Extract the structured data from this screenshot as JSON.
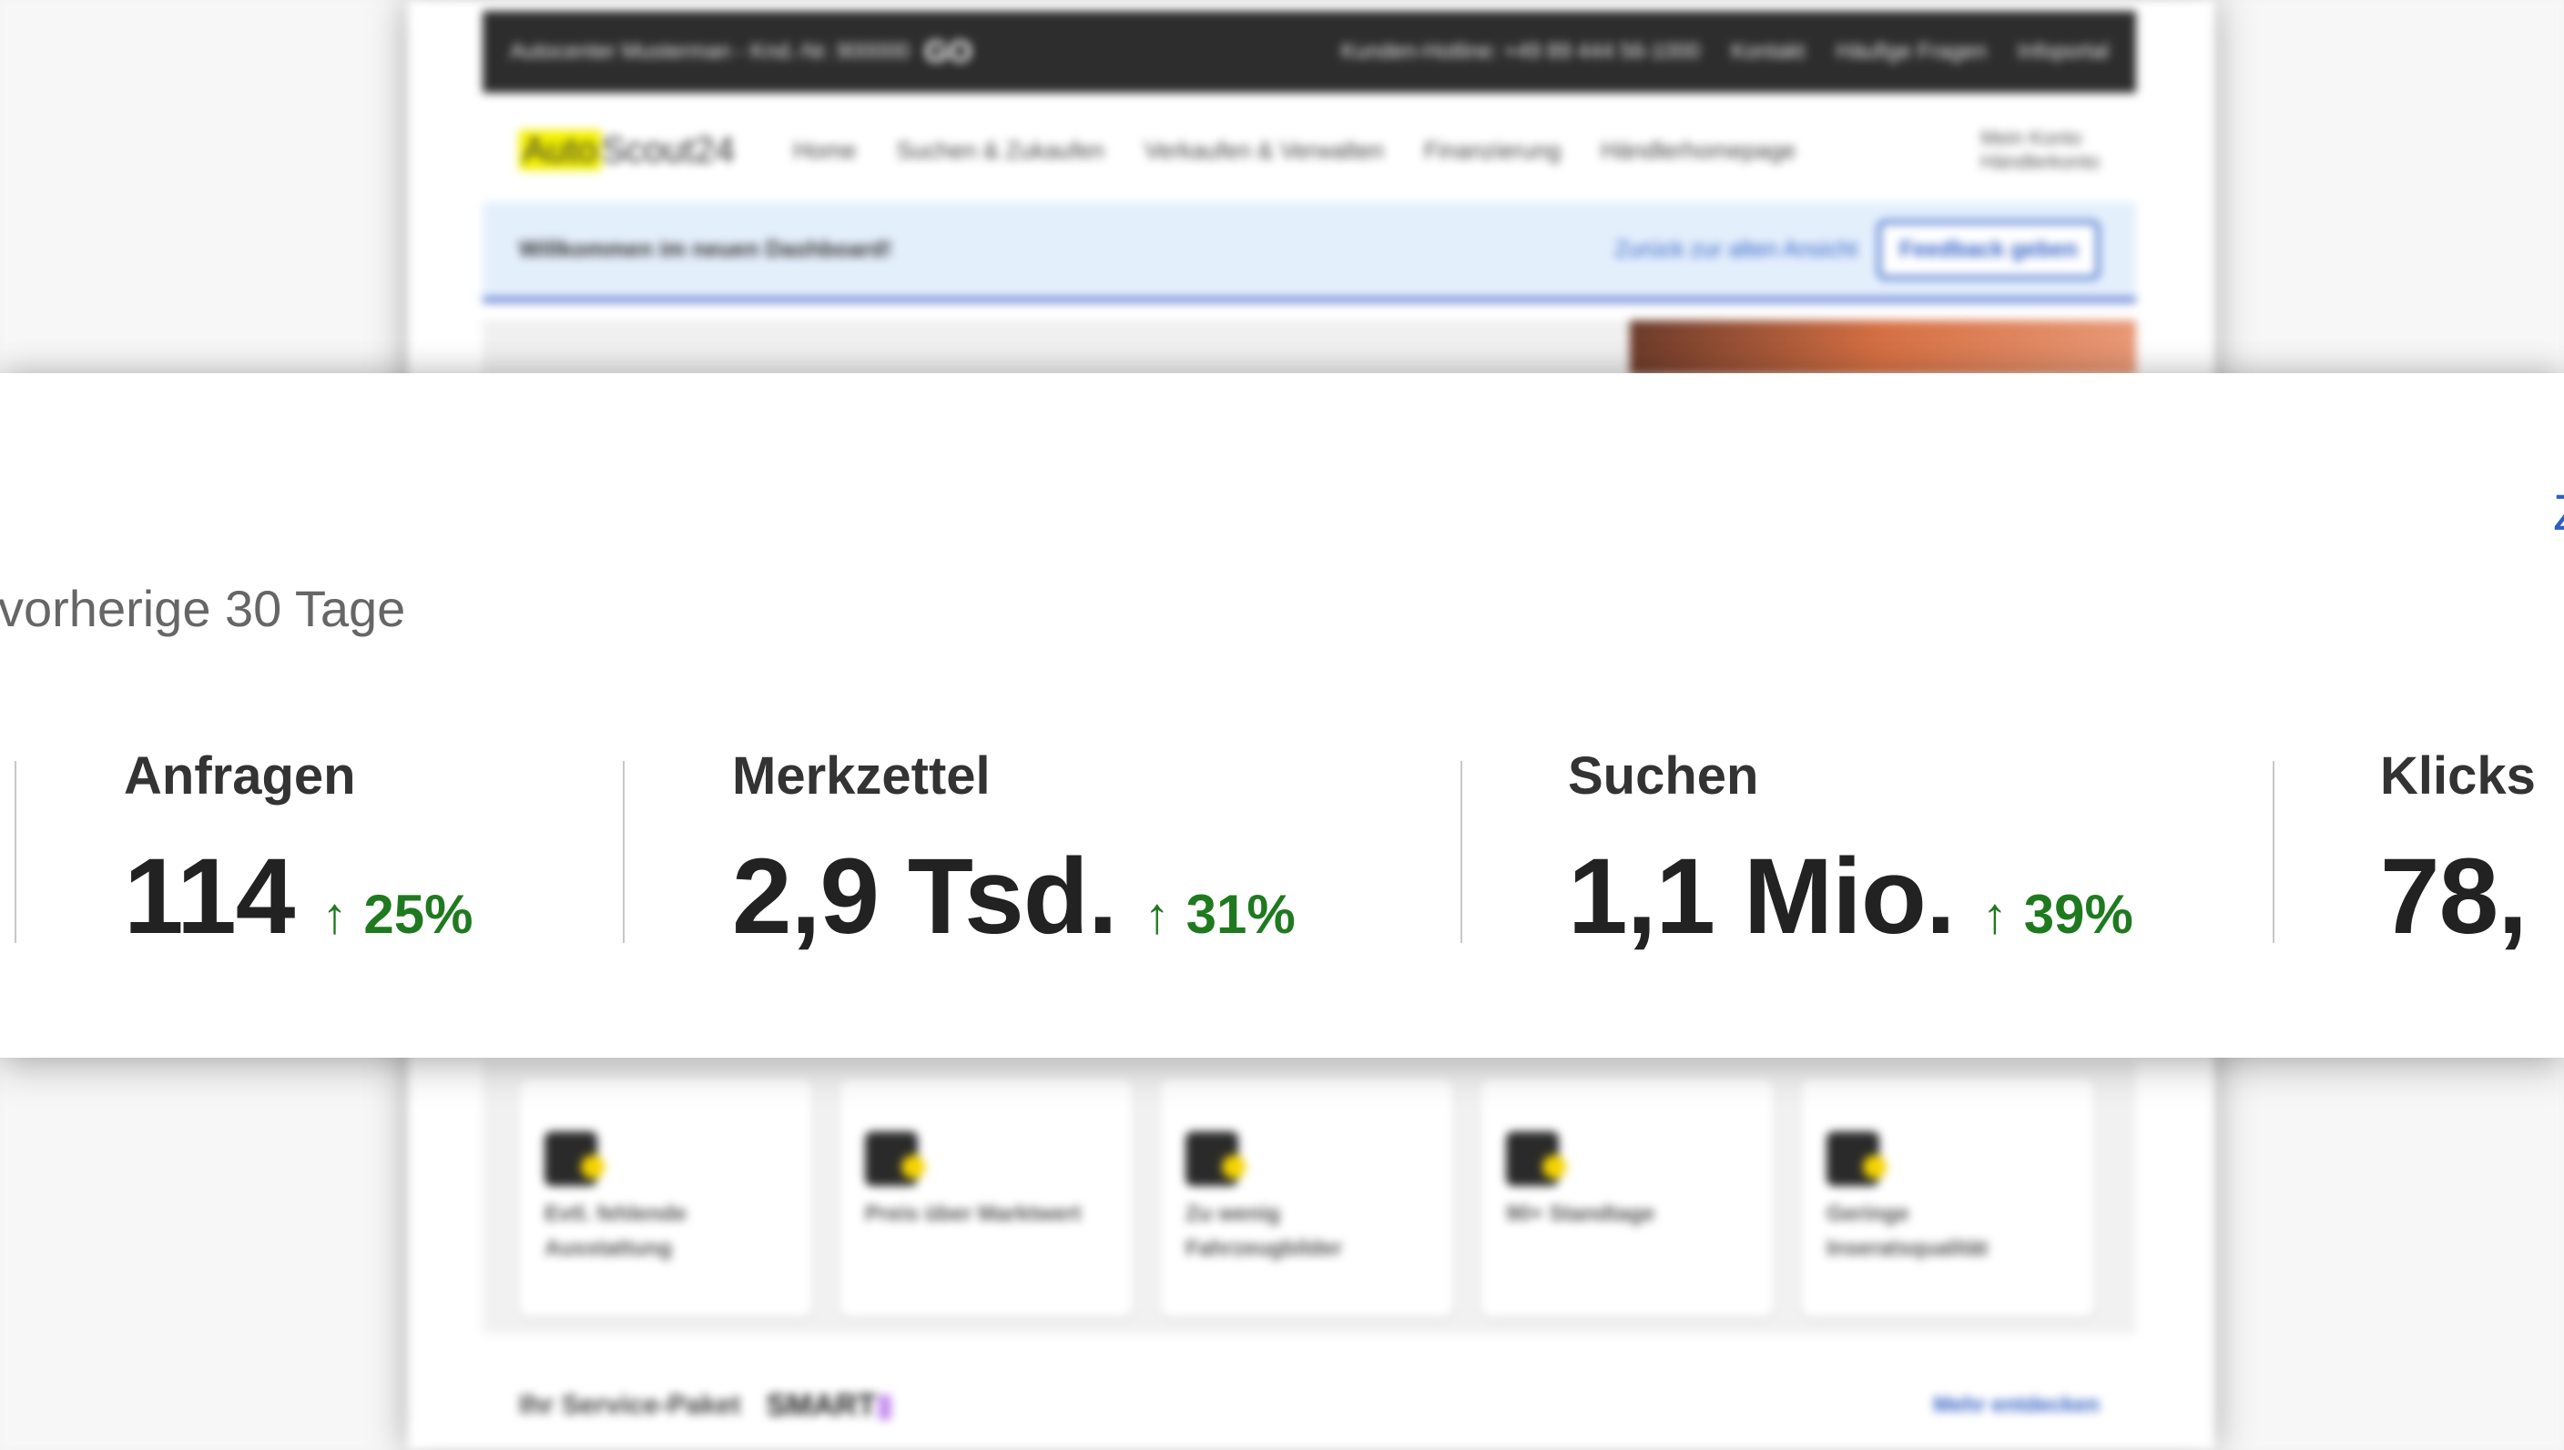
{
  "background": {
    "topbar": {
      "dealer": "Autocenter Musterman - Knd.-Nr. 900000",
      "go_badge": "GO",
      "links": [
        "Kunden-Hotline: +49 89 444 56-1000",
        "Kontakt",
        "Häufige Fragen",
        "Infoportal"
      ]
    },
    "nav": {
      "logo_highlight": "Auto",
      "logo_rest": "Scout24",
      "items": [
        "Home",
        "Suchen & Zukaufen",
        "Verkaufen & Verwalten",
        "Finanzierung",
        "Händlerhomepage"
      ],
      "account_title": "Mein Konto",
      "account_sub": "Händlerkonto"
    },
    "banner": {
      "text": "Willkommen im neuen Dashboard!",
      "back_link": "Zurück zur alten Ansicht",
      "feedback_button": "Feedback geben"
    },
    "cards": [
      "Evtl. fehlende Ausstattung",
      "Preis über Marktwert",
      "Zu wenig Fahrzeugbilder",
      "90+ Standtage",
      "Geringe Inseratsqualität"
    ],
    "service": {
      "label": "Ihr Service-Paket",
      "package": "SMART",
      "more_link": "Mehr entdecken"
    }
  },
  "stats": {
    "period": "vorherige 30 Tage",
    "edge_link": "Z",
    "items": [
      {
        "label": "Anfragen",
        "value": "114",
        "trend": "25%",
        "trend_icon": "arrow-up-icon"
      },
      {
        "label": "Merkzettel",
        "value": "2,9 Tsd.",
        "trend": "31%",
        "trend_icon": "arrow-up-icon"
      },
      {
        "label": "Suchen",
        "value": "1,1 Mio.",
        "trend": "39%",
        "trend_icon": "arrow-up-icon"
      },
      {
        "label": "Klicks",
        "value": "78,",
        "trend": "",
        "trend_icon": ""
      }
    ],
    "colors": {
      "trend_positive": "#1f7a1f",
      "link": "#2f5fc4",
      "logo_highlight": "#f5f200"
    }
  }
}
